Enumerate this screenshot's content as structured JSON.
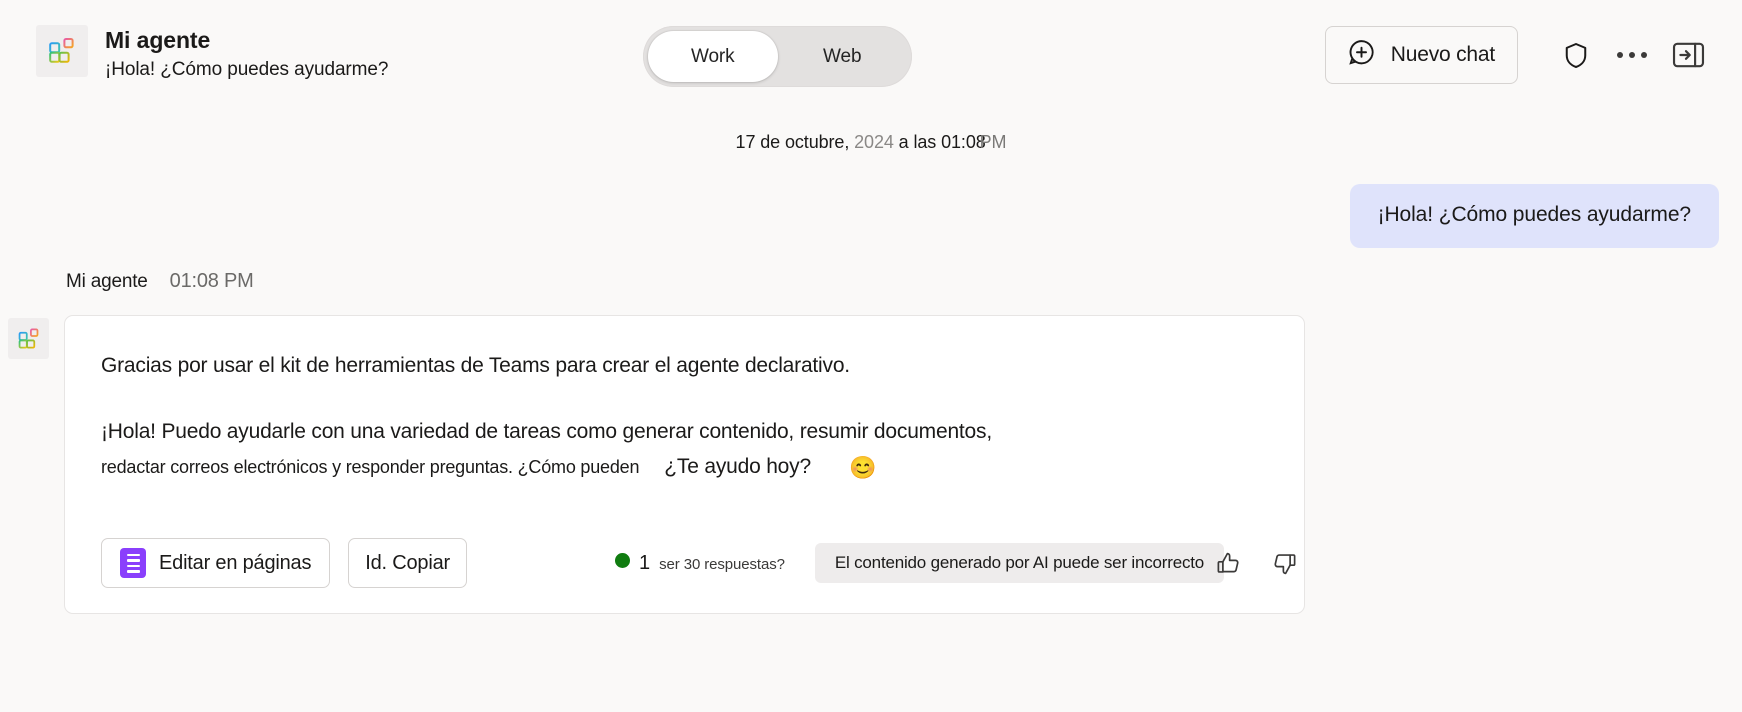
{
  "header": {
    "agent_name": "Mi agente",
    "agent_greeting": "¡Hola!  ¿Cómo puedes ayudarme?",
    "avatar_icon": "agent-blocks-icon",
    "scope_toggle": {
      "options": [
        {
          "label": "Work",
          "active": true
        },
        {
          "label": "Web",
          "active": false
        }
      ]
    },
    "actions": {
      "new_chat_label": "Nuevo chat",
      "new_chat_icon": "chat-add-icon",
      "shield_icon": "shield-icon",
      "more_icon": "more-horizontal-icon",
      "collapse_panel_icon": "panel-collapse-right-icon"
    }
  },
  "conversation": {
    "timestamp": {
      "date": "17 de octubre, ",
      "year": "2024",
      "separator": " a las 01:08",
      "ampm": "PM"
    },
    "user_message": "¡Hola!  ¿Cómo puedes ayudarme?",
    "agent_label": "Mi agente",
    "agent_time": "01:08 PM",
    "agent_avatar_icon": "agent-blocks-icon",
    "response": {
      "paragraph_1": "Gracias por usar el kit de herramientas de Teams para crear el agente declarativo.",
      "paragraph_2": "¡Hola!  Puedo ayudarle con una variedad de tareas como generar contenido, resumir documentos,",
      "paragraph_3_main": "redactar correos electrónicos y responder preguntas. ¿Cómo pueden",
      "paragraph_3_tail": "¿Te ayudo hoy?",
      "emoji": "😊"
    },
    "actions": {
      "edit_pages_label": "Editar en páginas",
      "edit_pages_icon": "pages-icon",
      "copy_label": "Id. Copiar",
      "response_count_number": "1",
      "response_count_text": "ser 30 respuestas?",
      "status_dot_color": "#107c10",
      "ai_notice": "El contenido generado por AI puede ser incorrecto",
      "thumbs_up_icon": "thumb-up-icon",
      "thumbs_down_icon": "thumb-down-icon"
    }
  },
  "colors": {
    "page_bg": "#faf9f8",
    "user_bubble": "#dfe3fb",
    "card_bg": "#ffffff",
    "accent_purple": "#8a3ffc",
    "status_green": "#107c10"
  }
}
